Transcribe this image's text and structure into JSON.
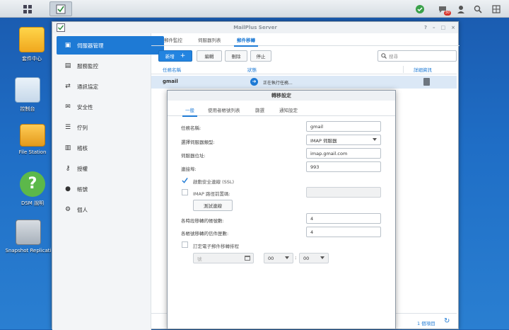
{
  "desktop_icons": [
    {
      "label": "套件中心",
      "icon": "package-center-icon"
    },
    {
      "label": "控制台",
      "icon": "control-panel-icon"
    },
    {
      "label": "File Station",
      "icon": "file-station-icon"
    },
    {
      "label": "DSM 說明",
      "icon": "help-icon"
    },
    {
      "label": "Snapshot Replicati",
      "icon": "snapshot-replication-icon"
    }
  ],
  "taskbar": {
    "notification_count": "30"
  },
  "window": {
    "title": "MailPlus Server"
  },
  "sidebar": {
    "items": [
      {
        "label": "伺服器管理",
        "icon": "server-management-icon"
      },
      {
        "label": "服務監控",
        "icon": "service-monitor-icon"
      },
      {
        "label": "通訊協定",
        "icon": "protocol-icon"
      },
      {
        "label": "安全性",
        "icon": "security-icon"
      },
      {
        "label": "佇列",
        "icon": "queue-icon"
      },
      {
        "label": "稽核",
        "icon": "audit-icon"
      },
      {
        "label": "授權",
        "icon": "license-icon"
      },
      {
        "label": "帳號",
        "icon": "account-icon"
      },
      {
        "label": "個人",
        "icon": "personal-icon"
      }
    ]
  },
  "tabs": [
    "郵件監控",
    "伺服器列表",
    "郵件移轉"
  ],
  "toolbar": {
    "add": "新增",
    "edit": "編輯",
    "delete": "刪除",
    "stop": "停止",
    "search_placeholder": "搜尋"
  },
  "table": {
    "headers": {
      "name": "任務名稱",
      "status": "狀態",
      "details": "詳細資訊"
    },
    "rows": [
      {
        "name": "gmail",
        "status": "正在執行任務..."
      }
    ]
  },
  "footer": {
    "count": "1 個項目"
  },
  "dialog": {
    "title": "轉移設定",
    "tabs": [
      "一般",
      "使用者帳號列表",
      "篩選",
      "通知設定"
    ],
    "task_name_label": "任務名稱:",
    "task_name_value": "gmail",
    "server_type_label": "選擇伺服器類型:",
    "server_type_value": "IMAP 伺服器",
    "server_address_label": "伺服器位址:",
    "server_address_value": "imap.gmail.com",
    "port_label": "連接埠:",
    "port_value": "993",
    "ssl_label": "啟動安全連線 (SSL)",
    "imap_prefix_label": "IMAP 路徑前置碼:",
    "test_button": "測試連線",
    "concurrent_accounts_label": "各時段移轉的帳號數:",
    "concurrent_accounts_value": "4",
    "emails_per_account_label": "各帳號移轉的信件匣數:",
    "emails_per_account_value": "4",
    "schedule_label": "訂定電子郵件移轉排程",
    "date_placeholder": "號",
    "hour_value": "00",
    "minute_value": "00",
    "time_separator": ":"
  },
  "colors": {
    "accent": "#1e7ad5",
    "desktop": "#1f6ec6"
  }
}
